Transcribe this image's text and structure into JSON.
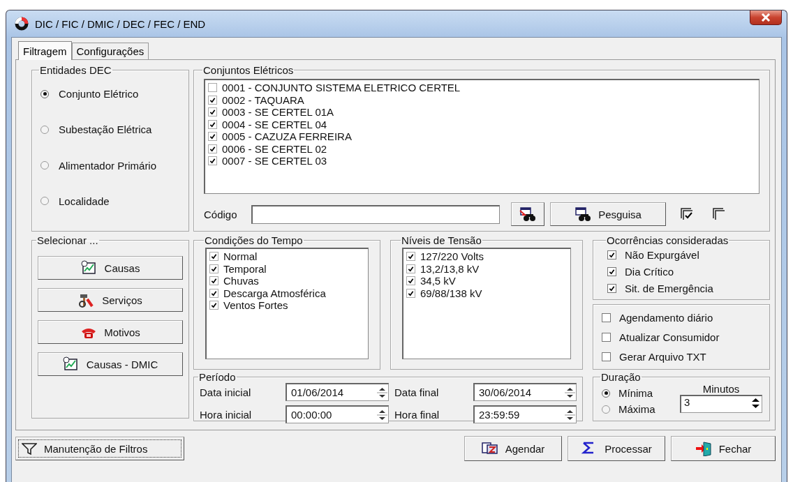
{
  "window": {
    "title": "DIC / FIC / DMIC / DEC / FEC / END"
  },
  "tabs": [
    {
      "label": "Filtragem",
      "selected": true
    },
    {
      "label": "Configurações",
      "selected": false
    }
  ],
  "entidades": {
    "title": "Entidades DEC",
    "options": [
      {
        "label": "Conjunto Elétrico",
        "selected": true
      },
      {
        "label": "Subestação Elétrica",
        "selected": false
      },
      {
        "label": "Alimentador Primário",
        "selected": false
      },
      {
        "label": "Localidade",
        "selected": false
      }
    ]
  },
  "selecionar": {
    "title": "Selecionar ...",
    "buttons": [
      "Causas",
      "Serviços",
      "Motivos",
      "Causas - DMIC"
    ]
  },
  "conjuntos": {
    "title": "Conjuntos Elétricos",
    "items": [
      {
        "label": "0001 - CONJUNTO SISTEMA ELETRICO CERTEL",
        "checked": false
      },
      {
        "label": "0002 - TAQUARA",
        "checked": true
      },
      {
        "label": "0003 - SE CERTEL 01A",
        "checked": true
      },
      {
        "label": "0004 - SE CERTEL 04",
        "checked": true
      },
      {
        "label": "0005 - CAZUZA FERREIRA",
        "checked": true
      },
      {
        "label": "0006 - SE CERTEL 02",
        "checked": true
      },
      {
        "label": "0007 - SE CERTEL 03",
        "checked": true
      }
    ],
    "codigo_label": "Código",
    "search_button": "Pesguisa"
  },
  "condicoes": {
    "title": "Condições do Tempo",
    "items": [
      {
        "label": "Normal",
        "checked": true
      },
      {
        "label": "Temporal",
        "checked": true
      },
      {
        "label": "Chuvas",
        "checked": true
      },
      {
        "label": "Descarga Atmosférica",
        "checked": true
      },
      {
        "label": "Ventos Fortes",
        "checked": true
      }
    ]
  },
  "niveis": {
    "title": "Níveis de Tensão",
    "items": [
      {
        "label": "127/220 Volts",
        "checked": true
      },
      {
        "label": "13,2/13,8 kV",
        "checked": true
      },
      {
        "label": "34,5 kV",
        "checked": true
      },
      {
        "label": "69/88/138 kV",
        "checked": true
      }
    ]
  },
  "ocorrencias": {
    "title": "Ocorrências consideradas",
    "items": [
      {
        "label": "Não Expurgável",
        "checked": true
      },
      {
        "label": "Dia Crítico",
        "checked": true
      },
      {
        "label": "Sit. de Emergência",
        "checked": true
      }
    ]
  },
  "opcoes": [
    {
      "label": "Agendamento diário",
      "checked": false
    },
    {
      "label": "Atualizar Consumidor",
      "checked": false
    },
    {
      "label": "Gerar Arquivo TXT",
      "checked": false
    }
  ],
  "periodo": {
    "title": "Período",
    "fields": [
      {
        "label": "Data inicial",
        "value": "01/06/2014"
      },
      {
        "label": "Data final",
        "value": "30/06/2014"
      },
      {
        "label": "Hora inicial",
        "value": "00:00:00"
      },
      {
        "label": "Hora final",
        "value": "23:59:59"
      }
    ]
  },
  "duracao": {
    "title": "Duração",
    "options": [
      {
        "label": "Mínima",
        "selected": true
      },
      {
        "label": "Máxima",
        "selected": false
      }
    ],
    "minutos_label": "Minutos",
    "minutos_value": "3"
  },
  "footer": {
    "filter_button": "Manutenção de Filtros",
    "buttons": [
      "Agendar",
      "Processar",
      "Fechar"
    ]
  }
}
